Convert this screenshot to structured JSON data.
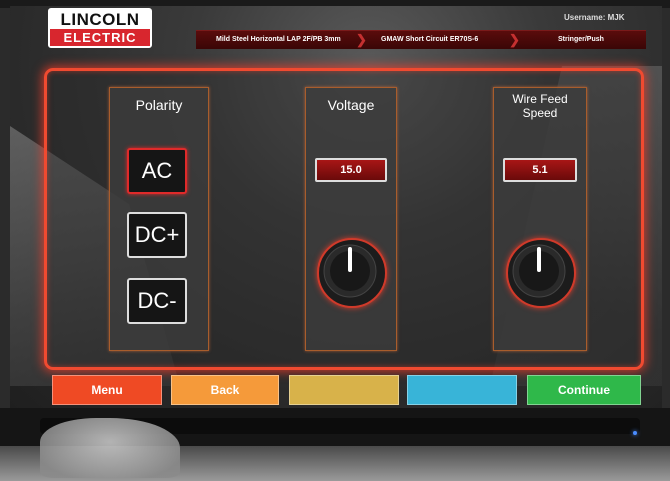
{
  "header": {
    "logo_top": "LINCOLN",
    "logo_bottom": "ELECTRIC",
    "username": "Username: MJK",
    "breadcrumb": [
      "Mild Steel Horizontal LAP 2F/PB 3mm",
      "GMAW Short Circuit ER70S-6",
      "Stringer/Push"
    ]
  },
  "polarity": {
    "title": "Polarity",
    "options": [
      "AC",
      "DC+",
      "DC-"
    ],
    "selected": "AC"
  },
  "voltage": {
    "title": "Voltage",
    "value": "15.0"
  },
  "wire_feed": {
    "title_line1": "Wire Feed",
    "title_line2": "Speed",
    "value": "5.1"
  },
  "buttons": {
    "menu": "Menu",
    "back": "Back",
    "blank1": "",
    "blank2": "",
    "continue": "Continue"
  },
  "colors": {
    "menu": "#ef4a24",
    "back": "#f59a3a",
    "blank1": "#d8b24a",
    "blank2": "#38b4d8",
    "continue": "#2fb84a",
    "accent": "#f04a30"
  }
}
